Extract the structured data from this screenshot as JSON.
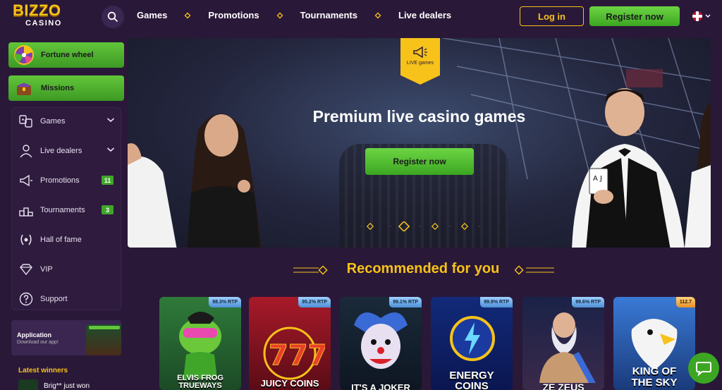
{
  "header": {
    "logo_top": "BIZZO",
    "logo_bottom": "CASINO",
    "nav": [
      "Games",
      "Promotions",
      "Tournaments",
      "Live dealers"
    ],
    "login_label": "Log in",
    "register_label": "Register now"
  },
  "sidebar": {
    "fortune_wheel": "Fortune wheel",
    "missions": "Missions",
    "items": [
      {
        "label": "Games",
        "icon": "games-icon",
        "chevron": true
      },
      {
        "label": "Live dealers",
        "icon": "live-dealer-icon",
        "chevron": true
      },
      {
        "label": "Promotions",
        "icon": "megaphone-icon",
        "badge": "11"
      },
      {
        "label": "Tournaments",
        "icon": "podium-icon",
        "badge": "3"
      },
      {
        "label": "Hall of fame",
        "icon": "laurel-icon"
      },
      {
        "label": "VIP",
        "icon": "diamond-icon"
      },
      {
        "label": "Support",
        "icon": "help-icon"
      }
    ],
    "app_title": "Application",
    "app_subtitle": "Download our app!",
    "latest_winners": "Latest winners",
    "winner_text": "Brig** just won"
  },
  "banner": {
    "tag": "LIVE games",
    "title": "Premium live casino games",
    "button": "Register now"
  },
  "recommended": {
    "title": "Recommended for you",
    "games": [
      {
        "name": "ELVIS FROG TRUEWAYS",
        "rtp": "98.3% RTP"
      },
      {
        "name": "JUICY COINS",
        "rtp": "95.2% RTP"
      },
      {
        "name": "IT'S A JOKER",
        "rtp": "99.1% RTP"
      },
      {
        "name": "ENERGY COINS",
        "rtp": "99.9% RTP"
      },
      {
        "name": "ZE ZEUS",
        "rtp": "99.6% RTP"
      },
      {
        "name": "KING OF THE SKY",
        "rtp": "112.7"
      }
    ]
  },
  "colors": {
    "background": "#2a1838",
    "accent_gold": "#f7c21a",
    "accent_green": "#4fb72f"
  }
}
